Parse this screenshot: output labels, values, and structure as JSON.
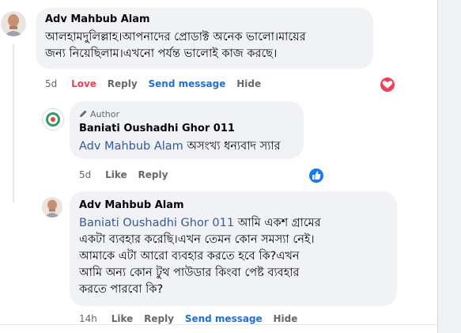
{
  "comment1": {
    "author": "Adv Mahbub Alam",
    "lines": [
      "আলহামদুলিল্লাহ।আপনাদের প্রোডাক্ট অনেক ভালো।মায়ের",
      "জন্য নিয়েছিলাম।এখনো পর্যন্ত ভালোই কাজ করছে।"
    ],
    "time": "5d",
    "love_label": "Love",
    "reply_label": "Reply",
    "send_message_label": "Send message",
    "hide_label": "Hide",
    "reaction": "love-icon"
  },
  "reply1": {
    "author_badge": "Author",
    "author": "Baniati Oushadhi Ghor 011",
    "mention": "Adv Mahbub Alam",
    "text": "অসংখ্য ধন্যবাদ স্যার",
    "time": "5d",
    "like_label": "Like",
    "reply_label": "Reply",
    "reaction": "like-icon"
  },
  "reply2": {
    "author": "Adv Mahbub Alam",
    "mention": "Baniati Oushadhi Ghor 011",
    "first_line_text": "আমি একশ গ্রামের",
    "lines": [
      "একটা ব্যবহার করেছি।এখন তেমন কোন সমস্যা নেই।",
      "আমাকে এটা আরো ব্যবহার করতে হবে কি?এখন",
      "আমি অন্য কোন টুথ পাউডার কিংবা পেষ্ট ব্যবহার",
      "করতে পারবো কি?"
    ],
    "time": "14h",
    "like_label": "Like",
    "reply_label": "Reply",
    "send_message_label": "Send message",
    "hide_label": "Hide"
  },
  "colors": {
    "link_blue": "#216fdb",
    "love_red": "#f33e58",
    "mention_blue": "#385898",
    "bubble_gray": "#f0f2f5"
  }
}
